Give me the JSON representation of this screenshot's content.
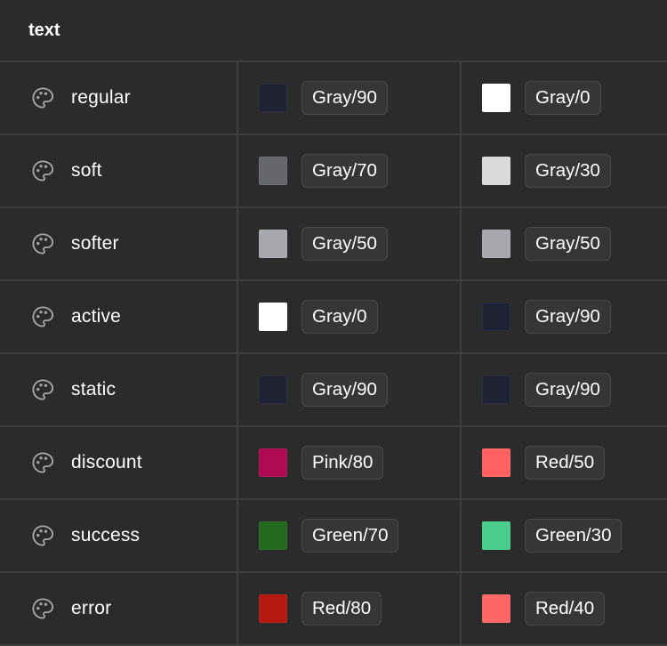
{
  "header": {
    "title": "text"
  },
  "icon": "palette-icon",
  "rows": [
    {
      "name": "regular",
      "light": {
        "label": "Gray/90",
        "color": "#1f2233"
      },
      "dark": {
        "label": "Gray/0",
        "color": "#ffffff"
      }
    },
    {
      "name": "soft",
      "light": {
        "label": "Gray/70",
        "color": "#66676c"
      },
      "dark": {
        "label": "Gray/30",
        "color": "#dadada"
      }
    },
    {
      "name": "softer",
      "light": {
        "label": "Gray/50",
        "color": "#a7a8ae"
      },
      "dark": {
        "label": "Gray/50",
        "color": "#a7a8ae"
      }
    },
    {
      "name": "active",
      "light": {
        "label": "Gray/0",
        "color": "#ffffff"
      },
      "dark": {
        "label": "Gray/90",
        "color": "#1f2233"
      }
    },
    {
      "name": "static",
      "light": {
        "label": "Gray/90",
        "color": "#1f2233"
      },
      "dark": {
        "label": "Gray/90",
        "color": "#1f2233"
      }
    },
    {
      "name": "discount",
      "light": {
        "label": "Pink/80",
        "color": "#b10a55"
      },
      "dark": {
        "label": "Red/50",
        "color": "#ff6161"
      }
    },
    {
      "name": "success",
      "light": {
        "label": "Green/70",
        "color": "#216a20"
      },
      "dark": {
        "label": "Green/30",
        "color": "#49cc8c"
      }
    },
    {
      "name": "error",
      "light": {
        "label": "Red/80",
        "color": "#b5180f"
      },
      "dark": {
        "label": "Red/40",
        "color": "#ff6666"
      }
    }
  ]
}
